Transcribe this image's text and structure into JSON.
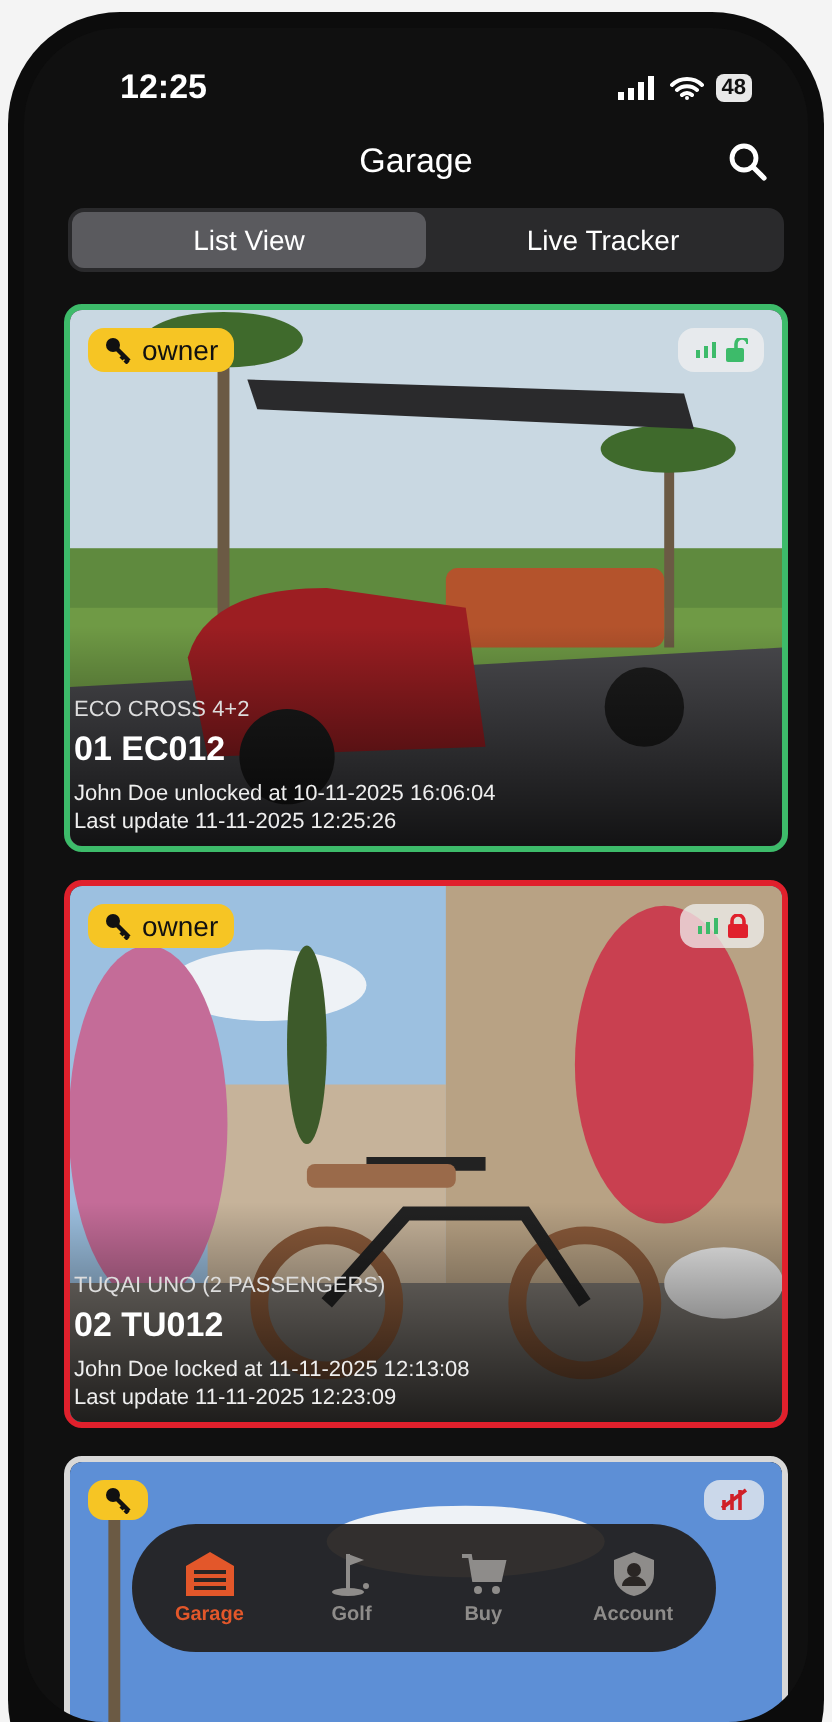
{
  "status_bar": {
    "time": "12:25",
    "battery": "48"
  },
  "header": {
    "title": "Garage"
  },
  "tabs": [
    {
      "label": "List View",
      "selected": true
    },
    {
      "label": "Live Tracker",
      "selected": false
    }
  ],
  "vehicles": [
    {
      "role": "owner",
      "kind": "unlocked",
      "model": "ECO CROSS 4+2",
      "plate": "01 EC012",
      "event": "John Doe unlocked at 10-11-2025 16:06:04",
      "updated": "Last update 11-11-2025 12:25:26"
    },
    {
      "role": "owner",
      "kind": "locked",
      "model": "TUQAI UNO (2 PASSENGERS)",
      "plate": "02 TU012",
      "event": "John Doe locked at 11-11-2025 12:13:08",
      "updated": "Last update 11-11-2025 12:23:09"
    },
    {
      "kind": "offline"
    }
  ],
  "nav": [
    {
      "label": "Garage",
      "kind": "garage",
      "selected": true
    },
    {
      "label": "Golf",
      "kind": "golf",
      "selected": false
    },
    {
      "label": "Buy",
      "kind": "cart",
      "selected": false
    },
    {
      "label": "Account",
      "kind": "account",
      "selected": false
    }
  ]
}
